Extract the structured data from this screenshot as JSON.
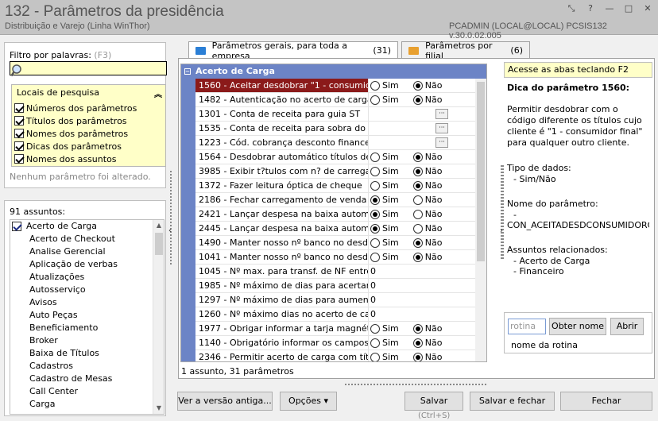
{
  "window": {
    "title": "132 - Parâmetros da presidência",
    "subtitle": "Distribuição e Varejo (Linha WinThor)",
    "user_info": "PCADMIN (LOCAL@LOCAL)   PCSIS132  v.30.0.02.005",
    "controls": [
      "⤡",
      "?",
      "—",
      "□",
      "✕"
    ]
  },
  "filter": {
    "label": "Filtro por palavras:",
    "hint": "(F3)",
    "value": ""
  },
  "locais": {
    "title": "Locais de pesquisa",
    "items": [
      {
        "label": "Números dos parâmetros",
        "checked": true
      },
      {
        "label": "Títulos dos parâmetros",
        "checked": true
      },
      {
        "label": "Nomes dos parâmetros",
        "checked": true
      },
      {
        "label": "Dicas dos parâmetros",
        "checked": true
      },
      {
        "label": "Nomes dos assuntos",
        "checked": true
      }
    ],
    "no_change": "Nenhum parâmetro foi alterado."
  },
  "subjects": {
    "count_label": "91 assuntos:",
    "items": [
      "Acerto de Carga",
      "Acerto de Checkout",
      "Analise Gerencial",
      "Aplicação de verbas",
      "Atualizações",
      "Autosserviço",
      "Avisos",
      "Auto Peças",
      "Beneficiamento",
      "Broker",
      "Baixa de Títulos",
      "Cadastros",
      "Cadastro de Mesas",
      "Call Center",
      "Carga"
    ]
  },
  "tabs": [
    {
      "label": "Parâmetros gerais, para toda a empresa",
      "count": "(31)",
      "underline": "P"
    },
    {
      "label": "Parâmetros por filial",
      "count": "(6)",
      "underline": "P"
    }
  ],
  "grid": {
    "header": "Acerto de Carga",
    "rows": [
      {
        "name": "1560 - Aceitar desdobrar \"1 - consumidor",
        "type": "radio",
        "sim": false,
        "selected": true
      },
      {
        "name": "1482 - Autenticação no acerto de carga",
        "type": "radio",
        "sim": false
      },
      {
        "name": "1301 - Conta de receita para guia ST",
        "type": "ellipsis"
      },
      {
        "name": "1535 - Conta de receita para sobra do ace",
        "type": "ellipsis"
      },
      {
        "name": "1223 - Cód. cobrança desconto financeiro",
        "type": "ellipsis"
      },
      {
        "name": "1564 - Desdobrar automático títulos de ca",
        "type": "radio",
        "sim": false
      },
      {
        "name": "3985 - Exibir t?tulos com n? de carregame",
        "type": "radio",
        "sim": false
      },
      {
        "name": "1372 - Fazer leitura óptica de cheque",
        "type": "radio",
        "sim": false
      },
      {
        "name": "2186 - Fechar carregamento de venda ba",
        "type": "radio",
        "sim": true
      },
      {
        "name": "2421 - Lançar despesa na baixa automátic",
        "type": "radio",
        "sim": true
      },
      {
        "name": "2445 - Lançar despesa na baixa automátic",
        "type": "radio",
        "sim": true
      },
      {
        "name": "1490 - Manter nosso nº banco no desdobr",
        "type": "radio",
        "sim": false
      },
      {
        "name": "1041 - Manter nosso nº banco no desdobr",
        "type": "radio",
        "sim": false
      },
      {
        "name": "1045 - Nº max. para transf. de NF entre c",
        "type": "number",
        "value": "0"
      },
      {
        "name": "1985 - Nº máximo de dias para acertar car",
        "type": "number",
        "value": "0"
      },
      {
        "name": "1297 - Nº máximo de dias para aumentar a",
        "type": "number",
        "value": "0"
      },
      {
        "name": "1260 - Nº máximo dias no acerto de carga",
        "type": "number",
        "value": "0"
      },
      {
        "name": "1977 - Obrigar informar a tarja magnética",
        "type": "radio",
        "sim": false
      },
      {
        "name": "1140 - Obrigatório informar os campos díg",
        "type": "radio",
        "sim": false
      },
      {
        "name": "2346 - Permitir acerto de carga com títulos",
        "type": "radio",
        "sim": false
      }
    ],
    "sim_label": "Sim",
    "nao_label": "Não",
    "status": "1 assunto, 31 parâmetros"
  },
  "help": {
    "bar": "Acesse as abas teclando F2",
    "title": "Dica do parâmetro 1560:",
    "text": "Permitir desdobrar com o código diferente os títulos cujo cliente é \"1 - consumidor final\" para qualquer outro cliente.",
    "tipo_label": "Tipo de dados:",
    "tipo_value": "- Sim/Não",
    "nome_label": "Nome do parâmetro:",
    "nome_dash": "-",
    "nome_value": "CON_ACEITADESDCONSUMIDOROUTRO",
    "assuntos_label": "Assuntos relacionados:",
    "assuntos": [
      "- Acerto de Carga",
      "- Financeiro"
    ],
    "rotina_placeholder": "rotina",
    "obter_label": "Obter nome",
    "abrir_label": "Abrir",
    "rotina_name": "nome da rotina"
  },
  "buttons": {
    "versao": "Ver a versão antiga...",
    "opcoes": "Opções ▾",
    "salvar": "Salvar",
    "salvar_shortcut": "(Ctrl+S)",
    "salvar_fechar": "Salvar e fechar",
    "fechar": "Fechar"
  }
}
